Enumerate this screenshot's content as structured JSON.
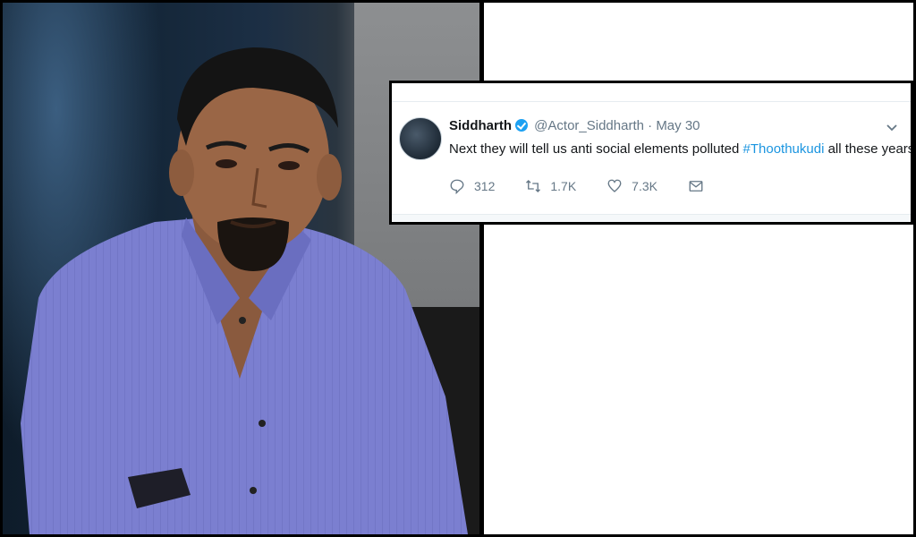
{
  "tweet": {
    "name": "Siddharth",
    "handle": "@Actor_Siddharth",
    "separator": "·",
    "date": "May 30",
    "text_before": "Next they will tell us anti social elements polluted ",
    "hashtag": "#Thoothukudi",
    "text_after": " all these years.",
    "replies": "312",
    "retweets": "1.7K",
    "likes": "7.3K",
    "caret_icon": "chevron-down-icon"
  },
  "colors": {
    "link": "#1b95e0",
    "verified": "#1da1f2",
    "muted": "#657786"
  }
}
